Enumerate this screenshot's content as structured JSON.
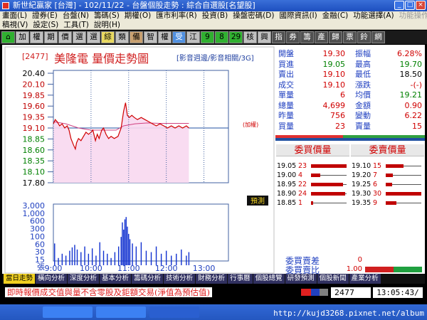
{
  "window": {
    "title": "新世紀贏家 [台灣] - 102/11/22 - 台盤個股走勢 : 綜合自選股[名望股]",
    "buttons": [
      "_",
      "□",
      "×"
    ]
  },
  "menu": {
    "row1": [
      "畫面(L)",
      "證券(E)",
      "台盤(N)",
      "籌碼(S)",
      "期權(O)",
      "匯市利率(R)",
      "投資(B)",
      "操盤密碼(D)",
      "國際資訊(I)",
      "金融(C)",
      "功能選擇(A)"
    ],
    "row1_disabled": [
      "功能操作(F)"
    ],
    "row2": [
      "稿視(V)",
      "設定(S)",
      "工具(T)",
      "說明(H)"
    ]
  },
  "toolbar": [
    {
      "label": "⌂",
      "style": "green"
    },
    {
      "label": "加",
      "style": "grey"
    },
    {
      "label": "權",
      "style": "grey"
    },
    {
      "label": "期",
      "style": "grey"
    },
    {
      "label": "價",
      "style": "grey"
    },
    {
      "label": "選",
      "style": "grey"
    },
    {
      "label": "選",
      "style": "grey"
    },
    {
      "label": "綜",
      "style": "yellow"
    },
    {
      "label": "類",
      "style": "grey"
    },
    {
      "label": "備",
      "style": "tan"
    },
    {
      "label": "智",
      "style": "grey"
    },
    {
      "label": "權",
      "style": "grey"
    },
    {
      "label": "受",
      "style": "blue"
    },
    {
      "label": "江",
      "style": "grey"
    },
    {
      "label": "9",
      "style": "green"
    },
    {
      "label": "8",
      "style": "green"
    },
    {
      "label": "29",
      "style": "green"
    },
    {
      "label": "核",
      "style": "grey"
    },
    {
      "label": "興",
      "style": "grey"
    },
    {
      "label": "指",
      "style": "dark"
    },
    {
      "label": "券",
      "style": "dark"
    },
    {
      "label": "籌",
      "style": "dark"
    },
    {
      "label": "產",
      "style": "dark"
    },
    {
      "label": "歸",
      "style": "dark"
    },
    {
      "label": "票",
      "style": "dark"
    },
    {
      "label": "鈴",
      "style": "dark"
    },
    {
      "label": "網",
      "style": "dark"
    }
  ],
  "stock": {
    "code": "[2477]",
    "title": "美隆電  量價走勢圖",
    "links": "[影音週邊/影音相關/3G]"
  },
  "quote": {
    "left": [
      {
        "label": "開盤",
        "value": "19.30",
        "color": "red"
      },
      {
        "label": "買進",
        "value": "19.05",
        "color": "green"
      },
      {
        "label": "賣出",
        "value": "19.10",
        "color": "red"
      },
      {
        "label": "成交",
        "value": "19.10",
        "color": "red"
      },
      {
        "label": "單量",
        "value": "6",
        "color": "red"
      },
      {
        "label": "總量",
        "value": "4,699",
        "color": "red"
      },
      {
        "label": "昨量",
        "value": "756",
        "color": "red"
      },
      {
        "label": "買量",
        "value": "23",
        "color": "red"
      }
    ],
    "right": [
      {
        "label": "振幅",
        "value": "6.28%",
        "color": "red"
      },
      {
        "label": "最高",
        "value": "19.70",
        "color": "green"
      },
      {
        "label": "最低",
        "value": "18.50",
        "color": "blk"
      },
      {
        "label": "漲跌",
        "value": "-(-)",
        "color": "red"
      },
      {
        "label": "均價",
        "value": "19.21",
        "color": "green"
      },
      {
        "label": "金額",
        "value": "0.90",
        "color": "red"
      },
      {
        "label": "變動",
        "value": "6.22",
        "color": "red"
      },
      {
        "label": "賣量",
        "value": "15",
        "color": "red"
      }
    ]
  },
  "orderbook": {
    "bid_title": "委買價量",
    "ask_title": "委賣價量",
    "bids": [
      {
        "price": "19.05",
        "vol": "23",
        "ratio": 1.0
      },
      {
        "price": "19.00",
        "vol": "4",
        "ratio": 0.25
      },
      {
        "price": "18.95",
        "vol": "22",
        "ratio": 0.9
      },
      {
        "price": "18.90",
        "vol": "24",
        "ratio": 0.95
      },
      {
        "price": "18.85",
        "vol": "1",
        "ratio": 0.06
      }
    ],
    "asks": [
      {
        "price": "19.10",
        "vol": "15",
        "ratio": 0.5
      },
      {
        "price": "19.20",
        "vol": "7",
        "ratio": 0.2
      },
      {
        "price": "19.25",
        "vol": "6",
        "ratio": 0.18
      },
      {
        "price": "19.30",
        "vol": "30",
        "ratio": 1.0
      },
      {
        "price": "19.35",
        "vol": "9",
        "ratio": 0.3
      }
    ],
    "diff_label": "委買賣差",
    "diff_value": "0",
    "ratio_label": "委買賣比",
    "ratio_value": "1.00"
  },
  "forecast_button": "預測",
  "avg_tag": "(加權)",
  "chart_data": {
    "type": "line",
    "price_axis": [
      "20.40",
      "20.10",
      "19.85",
      "19.60",
      "19.35",
      "19.10",
      "18.85",
      "18.60",
      "18.35",
      "18.10",
      "17.80"
    ],
    "volume_axis": [
      "3,000",
      "1,000",
      "600",
      "300",
      "100",
      "60",
      "30",
      "15"
    ],
    "volume_unit": "張",
    "x_ticks": [
      "9:00",
      "10:00",
      "11:00",
      "12:00",
      "13:00"
    ],
    "ylim": [
      17.8,
      20.4
    ],
    "reference": 19.1,
    "price": [
      [
        0,
        19.2
      ],
      [
        3,
        19.3
      ],
      [
        6,
        19.25
      ],
      [
        10,
        19.15
      ],
      [
        14,
        19.2
      ],
      [
        18,
        19.1
      ],
      [
        22,
        19.15
      ],
      [
        25,
        19.05
      ],
      [
        28,
        18.85
      ],
      [
        32,
        18.7
      ],
      [
        35,
        18.6
      ],
      [
        37,
        18.75
      ],
      [
        40,
        18.85
      ],
      [
        44,
        18.8
      ],
      [
        48,
        18.9
      ],
      [
        52,
        19.0
      ],
      [
        56,
        18.95
      ],
      [
        60,
        19.0
      ],
      [
        63,
        19.05
      ],
      [
        67,
        18.8
      ],
      [
        70,
        18.95
      ],
      [
        73,
        18.85
      ],
      [
        77,
        19.05
      ],
      [
        80,
        19.1
      ],
      [
        84,
        18.95
      ],
      [
        88,
        18.85
      ],
      [
        92,
        18.9
      ],
      [
        97,
        18.85
      ],
      [
        103,
        18.9
      ],
      [
        108,
        19.1
      ],
      [
        112,
        19.5
      ],
      [
        115,
        19.7
      ],
      [
        118,
        19.4
      ],
      [
        121,
        19.35
      ],
      [
        125,
        19.4
      ],
      [
        129,
        19.35
      ],
      [
        134,
        19.3
      ],
      [
        140,
        19.35
      ],
      [
        146,
        19.3
      ],
      [
        152,
        19.25
      ],
      [
        158,
        19.2
      ],
      [
        164,
        19.15
      ],
      [
        170,
        19.2
      ],
      [
        176,
        19.15
      ],
      [
        182,
        19.1
      ],
      [
        188,
        19.15
      ],
      [
        194,
        19.1
      ],
      [
        200,
        19.15
      ],
      [
        206,
        19.1
      ],
      [
        212,
        19.15
      ],
      [
        216,
        19.1
      ]
    ],
    "average": [
      [
        0,
        19.25
      ],
      [
        20,
        19.2
      ],
      [
        40,
        19.1
      ],
      [
        60,
        19.05
      ],
      [
        80,
        19.05
      ],
      [
        100,
        19.05
      ],
      [
        112,
        19.15
      ],
      [
        130,
        19.2
      ],
      [
        150,
        19.22
      ],
      [
        170,
        19.21
      ],
      [
        190,
        19.21
      ],
      [
        216,
        19.21
      ]
    ],
    "volume": [
      [
        2,
        80
      ],
      [
        8,
        20
      ],
      [
        14,
        30
      ],
      [
        20,
        25
      ],
      [
        26,
        40
      ],
      [
        30,
        55
      ],
      [
        34,
        70
      ],
      [
        38,
        45
      ],
      [
        44,
        35
      ],
      [
        50,
        60
      ],
      [
        56,
        30
      ],
      [
        62,
        50
      ],
      [
        68,
        25
      ],
      [
        74,
        90
      ],
      [
        80,
        40
      ],
      [
        86,
        30
      ],
      [
        92,
        20
      ],
      [
        98,
        35
      ],
      [
        104,
        60
      ],
      [
        108,
        150
      ],
      [
        110,
        600
      ],
      [
        112,
        300
      ],
      [
        114,
        800
      ],
      [
        116,
        1000
      ],
      [
        118,
        400
      ],
      [
        120,
        200
      ],
      [
        122,
        120
      ],
      [
        126,
        80
      ],
      [
        132,
        60
      ],
      [
        140,
        90
      ],
      [
        148,
        40
      ],
      [
        156,
        35
      ],
      [
        164,
        60
      ],
      [
        172,
        30
      ],
      [
        180,
        40
      ],
      [
        188,
        25
      ],
      [
        196,
        30
      ],
      [
        204,
        45
      ],
      [
        212,
        25
      ],
      [
        216,
        35
      ]
    ],
    "session_minutes": 270
  },
  "tabs": [
    "當日走勢",
    "橫向分析",
    "深度分析",
    "基本分析",
    "籌碼分析",
    "技術分析",
    "財務分析",
    "行事曆",
    "個股總覽",
    "研發預測",
    "個股新聞",
    "產業分析"
  ],
  "status": {
    "notice": "即時報價成交值與量不含零股及鉅額交易(淨值為預估值)",
    "code": "2477",
    "clock": "13:05:43/"
  },
  "watermark": "http://kujd3268.pixnet.net/album"
}
